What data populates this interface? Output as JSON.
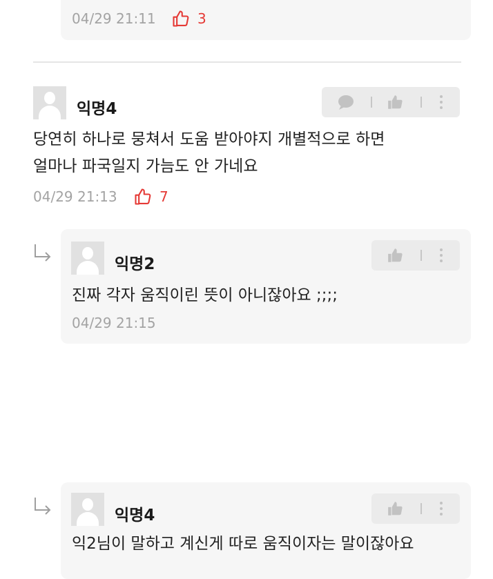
{
  "top_reply": {
    "time": "04/29 21:11",
    "likes": "3"
  },
  "comment": {
    "author": "익명4",
    "text_lines": [
      "당연히 하나로 뭉쳐서 도움 받아야지 개별적으로 하면",
      "얼마나 파국일지 가늠도 안 가네요"
    ],
    "time": "04/29 21:13",
    "likes": "7"
  },
  "replies": [
    {
      "author": "익명2",
      "text": "진짜 각자 움직이린 뜻이 아니잖아요 ;;;;",
      "time": "04/29 21:15"
    },
    {
      "author": "익명4",
      "text": "익2님이 말하고 계신게 따로 움직이자는 말이잖아요"
    }
  ],
  "icons": {
    "reply_arrow": "reply-arrow-icon",
    "chat": "chat-bubble-icon",
    "like": "thumbs-up-icon",
    "more": "more-vertical-icon"
  },
  "colors": {
    "likes": "#e53935",
    "meta": "#a3a3a3",
    "box": "#f6f6f6",
    "action_bar": "#ebebeb"
  }
}
